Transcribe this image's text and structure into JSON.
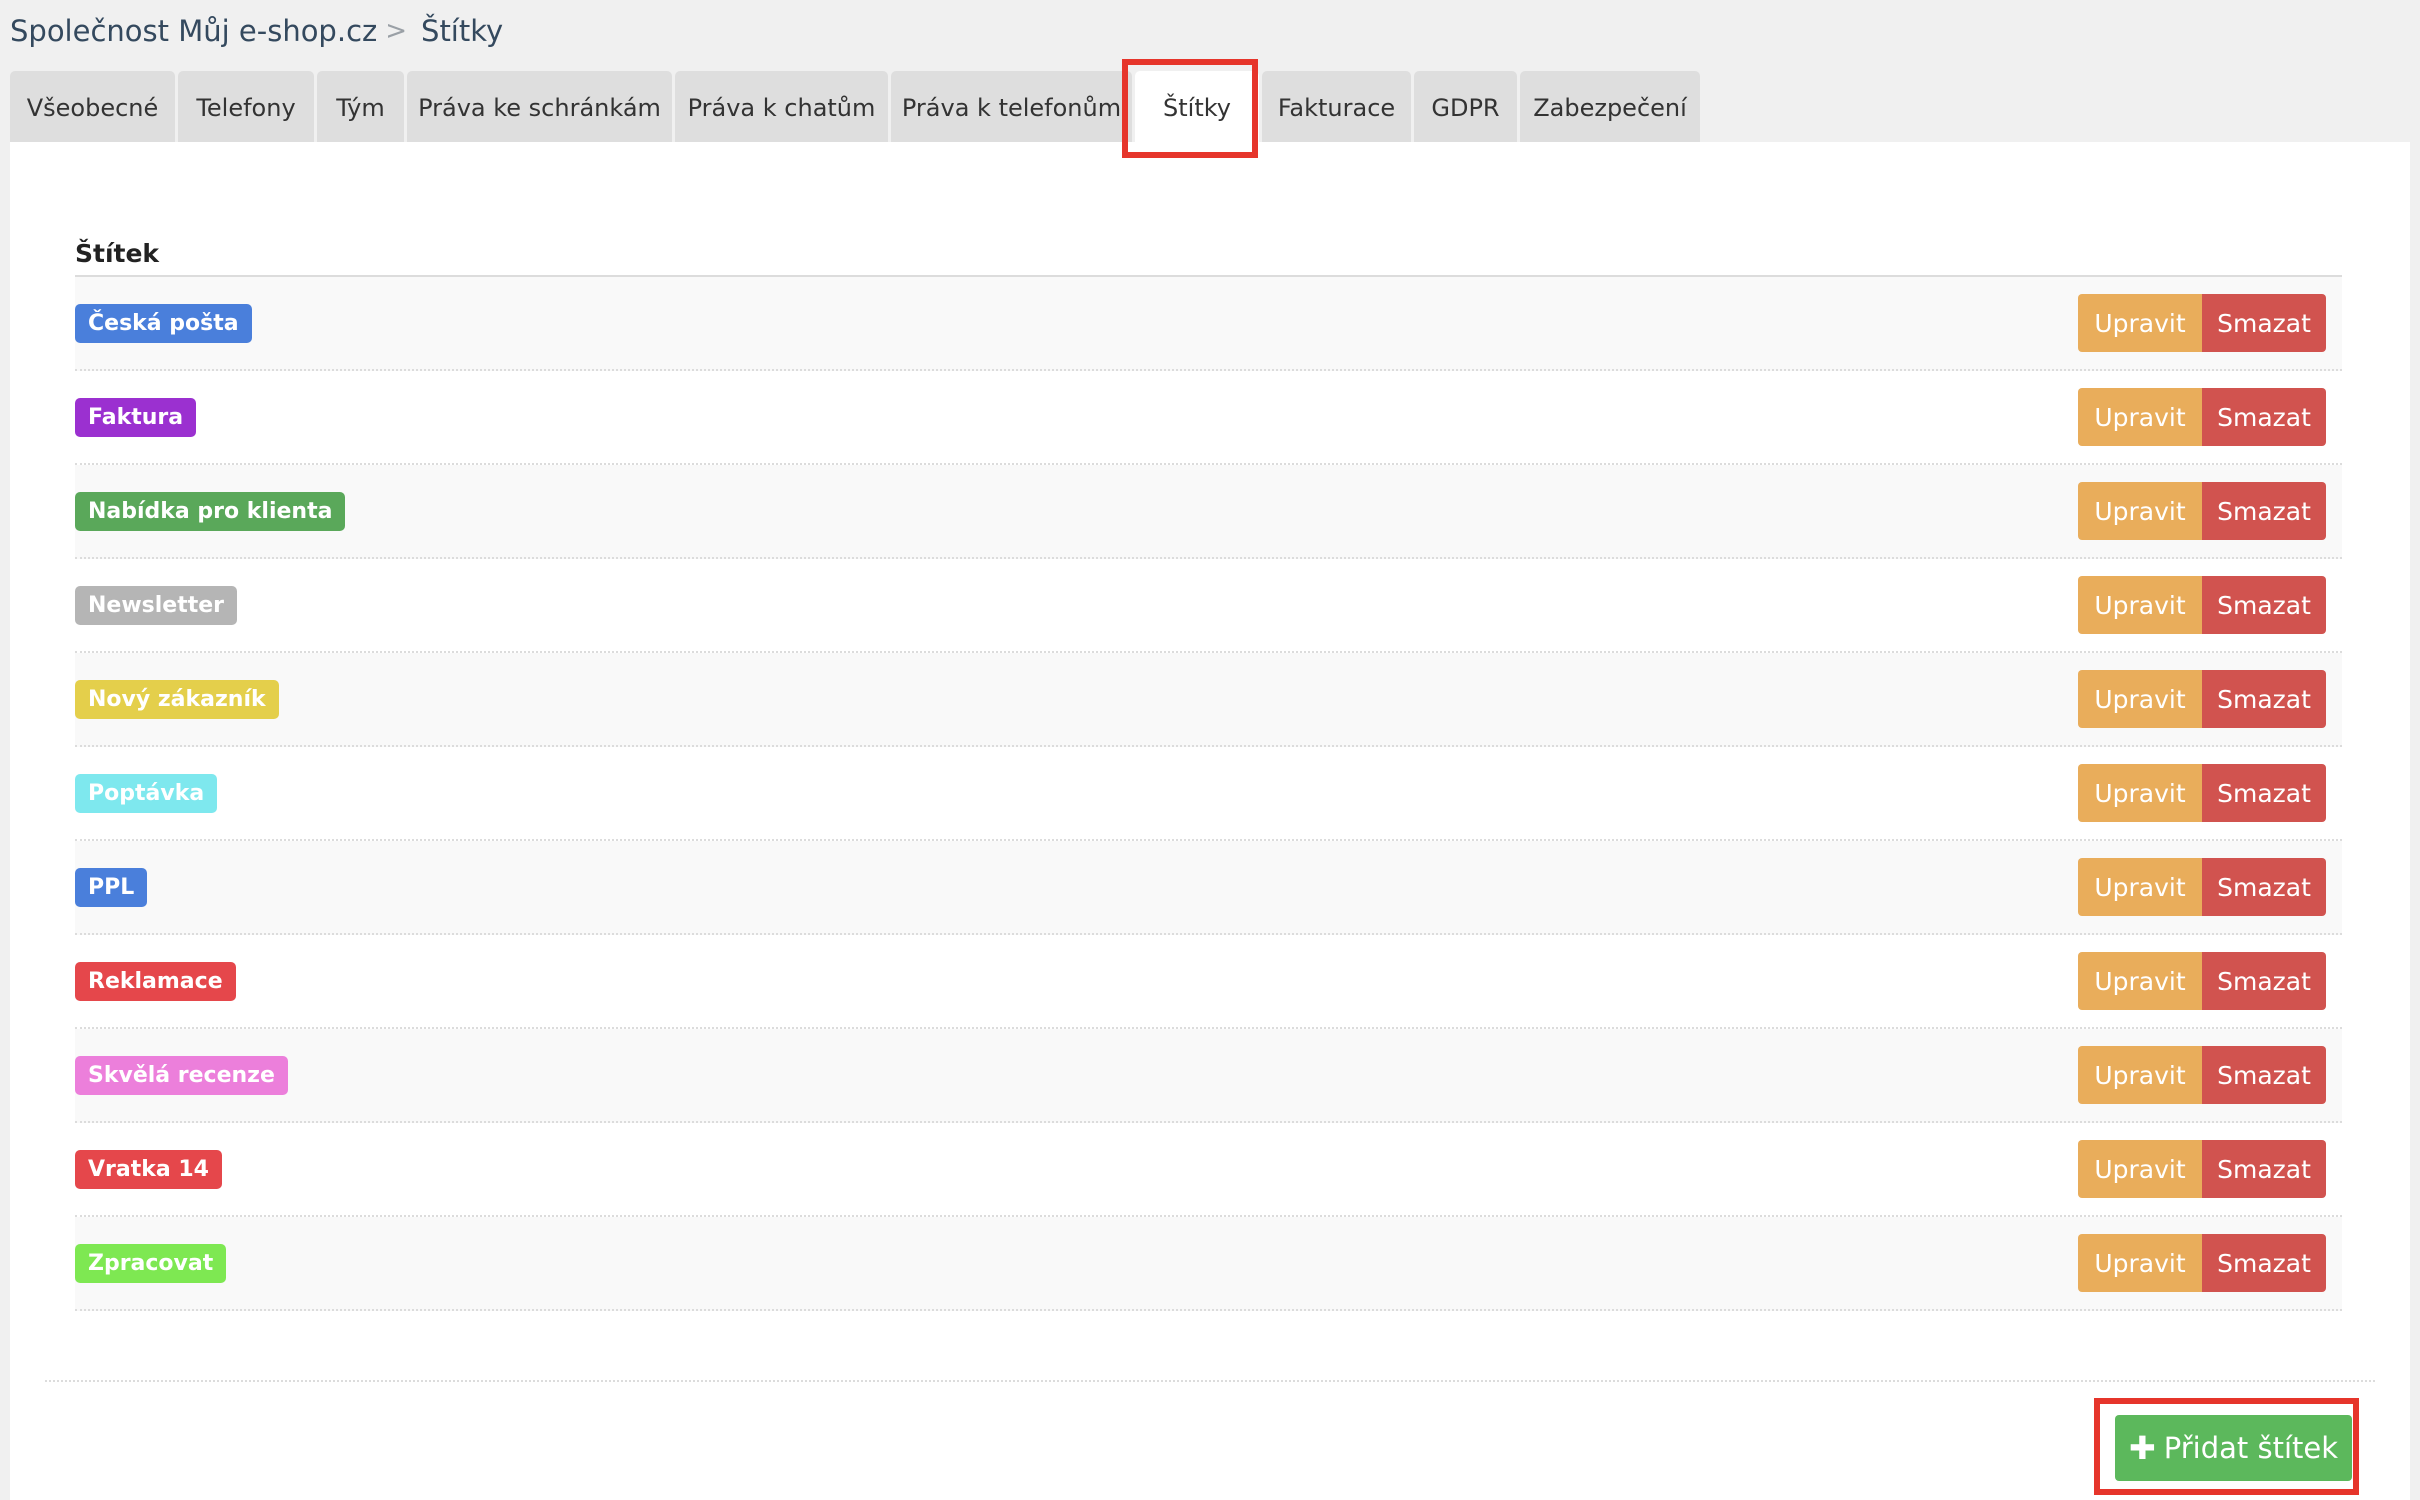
{
  "breadcrumb": {
    "company": "Společnost Můj e-shop.cz",
    "separator": ">",
    "current": "Štítky"
  },
  "tabs": [
    {
      "label": "Všeobecné",
      "active": false
    },
    {
      "label": "Telefony",
      "active": false
    },
    {
      "label": "Tým",
      "active": false
    },
    {
      "label": "Práva ke schránkám",
      "active": false
    },
    {
      "label": "Práva k chatům",
      "active": false
    },
    {
      "label": "Práva k telefonům",
      "active": false
    },
    {
      "label": "Štítky",
      "active": true
    },
    {
      "label": "Fakturace",
      "active": false
    },
    {
      "label": "GDPR",
      "active": false
    },
    {
      "label": "Zabezpečení",
      "active": false
    }
  ],
  "table": {
    "column_header": "Štítek",
    "edit_label": "Upravit",
    "delete_label": "Smazat",
    "rows": [
      {
        "label": "Česká pošta",
        "color": "#4a7fdb"
      },
      {
        "label": "Faktura",
        "color": "#9b30d0"
      },
      {
        "label": "Nabídka pro klienta",
        "color": "#5aa85a"
      },
      {
        "label": "Newsletter",
        "color": "#b5b5b5"
      },
      {
        "label": "Nový zákazník",
        "color": "#e4cf4b"
      },
      {
        "label": "Poptávka",
        "color": "#7ee8ee"
      },
      {
        "label": "PPL",
        "color": "#4a7fdb"
      },
      {
        "label": "Reklamace",
        "color": "#e5474b"
      },
      {
        "label": "Skvělá recenze",
        "color": "#ec7fdb"
      },
      {
        "label": "Vratka 14",
        "color": "#e5474b"
      },
      {
        "label": "Zpracovat",
        "color": "#7ee852"
      }
    ]
  },
  "add_button": {
    "label": "Přidat štítek",
    "icon": "plus-icon"
  },
  "colors": {
    "edit": "#e9ad5b",
    "delete": "#d1534f",
    "add": "#5cb85c",
    "highlight": "#e6352b"
  }
}
